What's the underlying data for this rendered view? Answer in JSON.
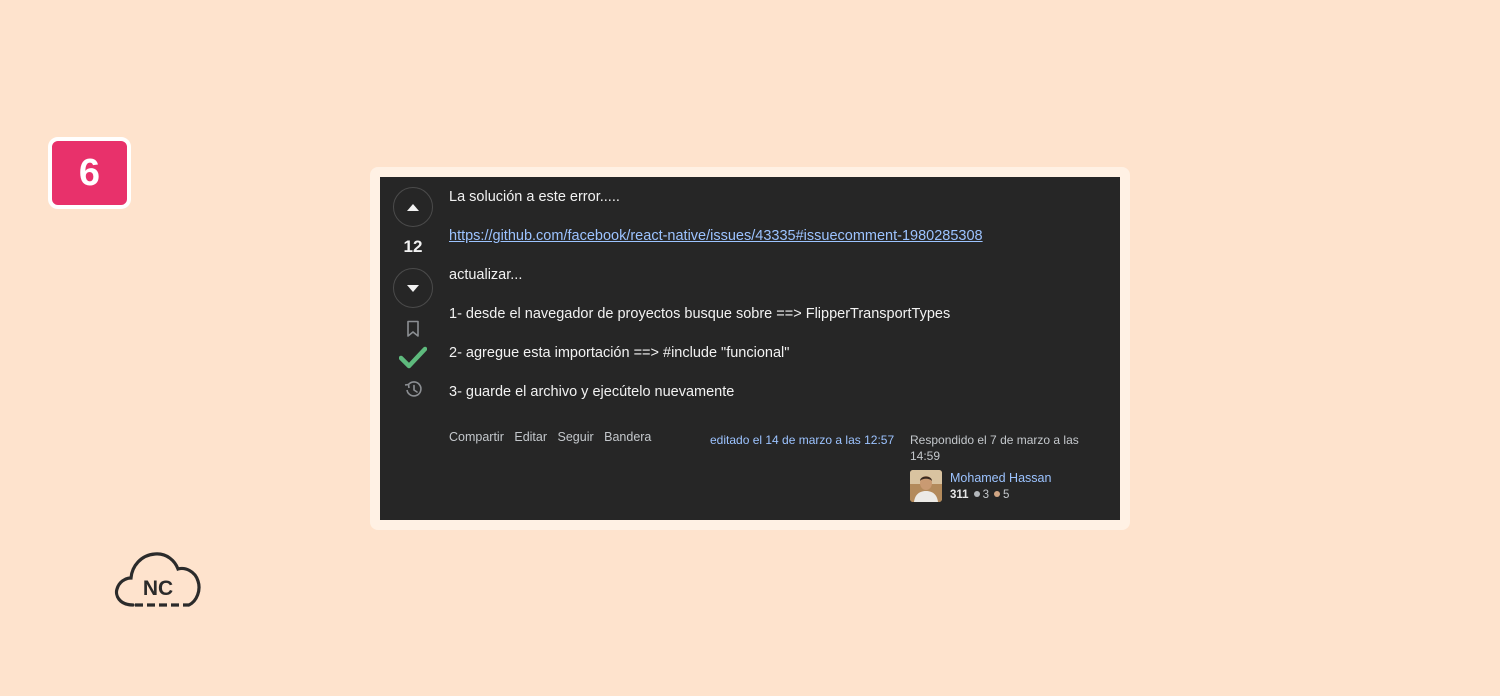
{
  "step_badge": "6",
  "logo": {
    "text": "NC",
    "icon": "cloud-icon"
  },
  "answer": {
    "vote_count": "12",
    "accepted": true,
    "colors": {
      "accepted": "#5eba7d",
      "link": "#9cc3ff",
      "background": "#262626"
    },
    "body": {
      "line1": "La solución a este error.....",
      "link": "https://github.com/facebook/react-native/issues/43335#issuecomment-1980285308",
      "line2": "actualizar...",
      "line3": "1- desde el navegador de proyectos busque sobre ==> FlipperTransportTypes",
      "line4": "2- agregue esta importación ==> #include \"funcional\"",
      "line5": "3- guarde el archivo y ejecútelo nuevamente"
    },
    "menu": {
      "share": "Compartir",
      "edit": "Editar",
      "follow": "Seguir",
      "flag": "Bandera"
    },
    "edited": "editado el 14 de marzo a las 12:57",
    "answered": "Respondido el 7 de marzo a las 14:59",
    "user": {
      "name": "Mohamed Hassan",
      "reputation": "311",
      "silver_badges": "3",
      "bronze_badges": "5",
      "colors": {
        "silver": "#b4b8bc",
        "bronze": "#d1a684"
      }
    }
  }
}
